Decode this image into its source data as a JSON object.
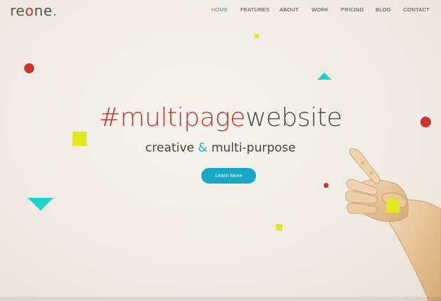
{
  "header": {
    "logo": {
      "part1": "re",
      "part2": "o",
      "part3": "ne",
      "dot": "."
    },
    "nav": [
      {
        "label": "HOME",
        "active": true
      },
      {
        "label": "FEATURES",
        "active": false
      },
      {
        "label": "ABOUT",
        "active": false
      },
      {
        "label": "WORK",
        "active": false
      },
      {
        "label": "PRICING",
        "active": false
      },
      {
        "label": "BLOG",
        "active": false
      },
      {
        "label": "CONTACT",
        "active": false
      }
    ]
  },
  "hero": {
    "headline_highlight": "#multipage",
    "headline_rest": "website",
    "sub_part1": "creative ",
    "sub_amp": "&",
    "sub_part2": " multi-purpose",
    "cta_label": "Learn More"
  },
  "colors": {
    "accent": "#18a7c7",
    "red": "#cf3329",
    "yellow": "#e1e81d",
    "teal": "#19d6c9"
  }
}
